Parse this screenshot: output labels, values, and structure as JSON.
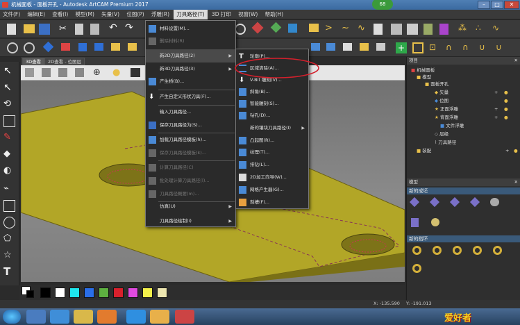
{
  "window": {
    "title": "机械面板 - 面板开孔 - Autodesk ArtCAM Premium 2017",
    "badge": "68"
  },
  "menubar": [
    "文件(F)",
    "编辑(E)",
    "查看(I)",
    "模型(M)",
    "矢量(V)",
    "位图(P)",
    "浮雕(R)",
    "刀具路径(T)",
    "3D 打印",
    "视窗(W)",
    "帮助(H)"
  ],
  "view_tabs": [
    "3D查看",
    "2D查看 - 位图层"
  ],
  "toolpaths_menu": {
    "items": [
      {
        "label": "材料设置(M)...",
        "enabled": true,
        "submenu": false
      },
      {
        "label": "删除材料(R)",
        "enabled": false,
        "submenu": false
      },
      {
        "label": "新2D刀具路径(2)",
        "enabled": true,
        "submenu": true,
        "highlighted": true
      },
      {
        "label": "新3D刀具路径(3)",
        "enabled": true,
        "submenu": true
      },
      {
        "label": "产生桥(B)...",
        "enabled": true,
        "submenu": false
      },
      {
        "label": "产生自定义形状刀具(F)...",
        "enabled": true,
        "submenu": false
      },
      {
        "label": "输入刀具路径...",
        "enabled": true,
        "submenu": false
      },
      {
        "label": "保存刀具路径为(S)...",
        "enabled": true,
        "submenu": false
      },
      {
        "label": "加载刀具路径模板(h)...",
        "enabled": true,
        "submenu": false
      },
      {
        "label": "保存刀具路径模板(k)...",
        "enabled": false,
        "submenu": false
      },
      {
        "label": "计算刀具路径(C)",
        "enabled": false,
        "submenu": false
      },
      {
        "label": "批处理计算刀具路径(l)...",
        "enabled": false,
        "submenu": false
      },
      {
        "label": "刀具路径概要(m)...",
        "enabled": false,
        "submenu": false
      },
      {
        "label": "仿真(U)",
        "enabled": true,
        "submenu": true
      },
      {
        "label": "刀具路径绘制(i)",
        "enabled": true,
        "submenu": true
      }
    ]
  },
  "submenu_2d": {
    "items": [
      {
        "label": "轮廓(P)...",
        "submenu": false
      },
      {
        "label": "区域清除(A)...",
        "submenu": false,
        "circled": true
      },
      {
        "label": "V-Bit 雕刻(V)...",
        "submenu": false
      },
      {
        "label": "斜角(B)...",
        "submenu": false
      },
      {
        "label": "智能雕刻(S)...",
        "submenu": false
      },
      {
        "label": "钻孔(D)...",
        "submenu": false
      },
      {
        "label": "新的镶块刀具路径(I)",
        "submenu": true
      },
      {
        "label": "凸起图(R)...",
        "submenu": false
      },
      {
        "label": "纹理(T)...",
        "submenu": false
      },
      {
        "label": "排钻(L)...",
        "submenu": false
      },
      {
        "label": "2D加工向导(W)...",
        "submenu": false
      },
      {
        "label": "网格产生器(G)...",
        "submenu": false
      },
      {
        "label": "刻槽(F)...",
        "submenu": false
      }
    ]
  },
  "project_panel": {
    "title": "项目",
    "tree": [
      "机械面板",
      "模型",
      "面板开孔",
      "矢量",
      "位图",
      "正面浮雕",
      "背面浮雕",
      "文件浮雕",
      "层级",
      "刀具路径",
      "装配"
    ]
  },
  "model_panel": {
    "title": "模型",
    "section1": "新的成坯",
    "section2": "新的指环"
  },
  "palette_colors": [
    "#000000",
    "#ffffff",
    "#1ee6ee",
    "#2a6ee8",
    "#5db040",
    "#d8202c",
    "#e04adf",
    "#f2f04a",
    "#ede6b0"
  ],
  "status": {
    "x": "X: -135.590",
    "y": "Y: -191.013"
  },
  "watermark": "爱好者"
}
